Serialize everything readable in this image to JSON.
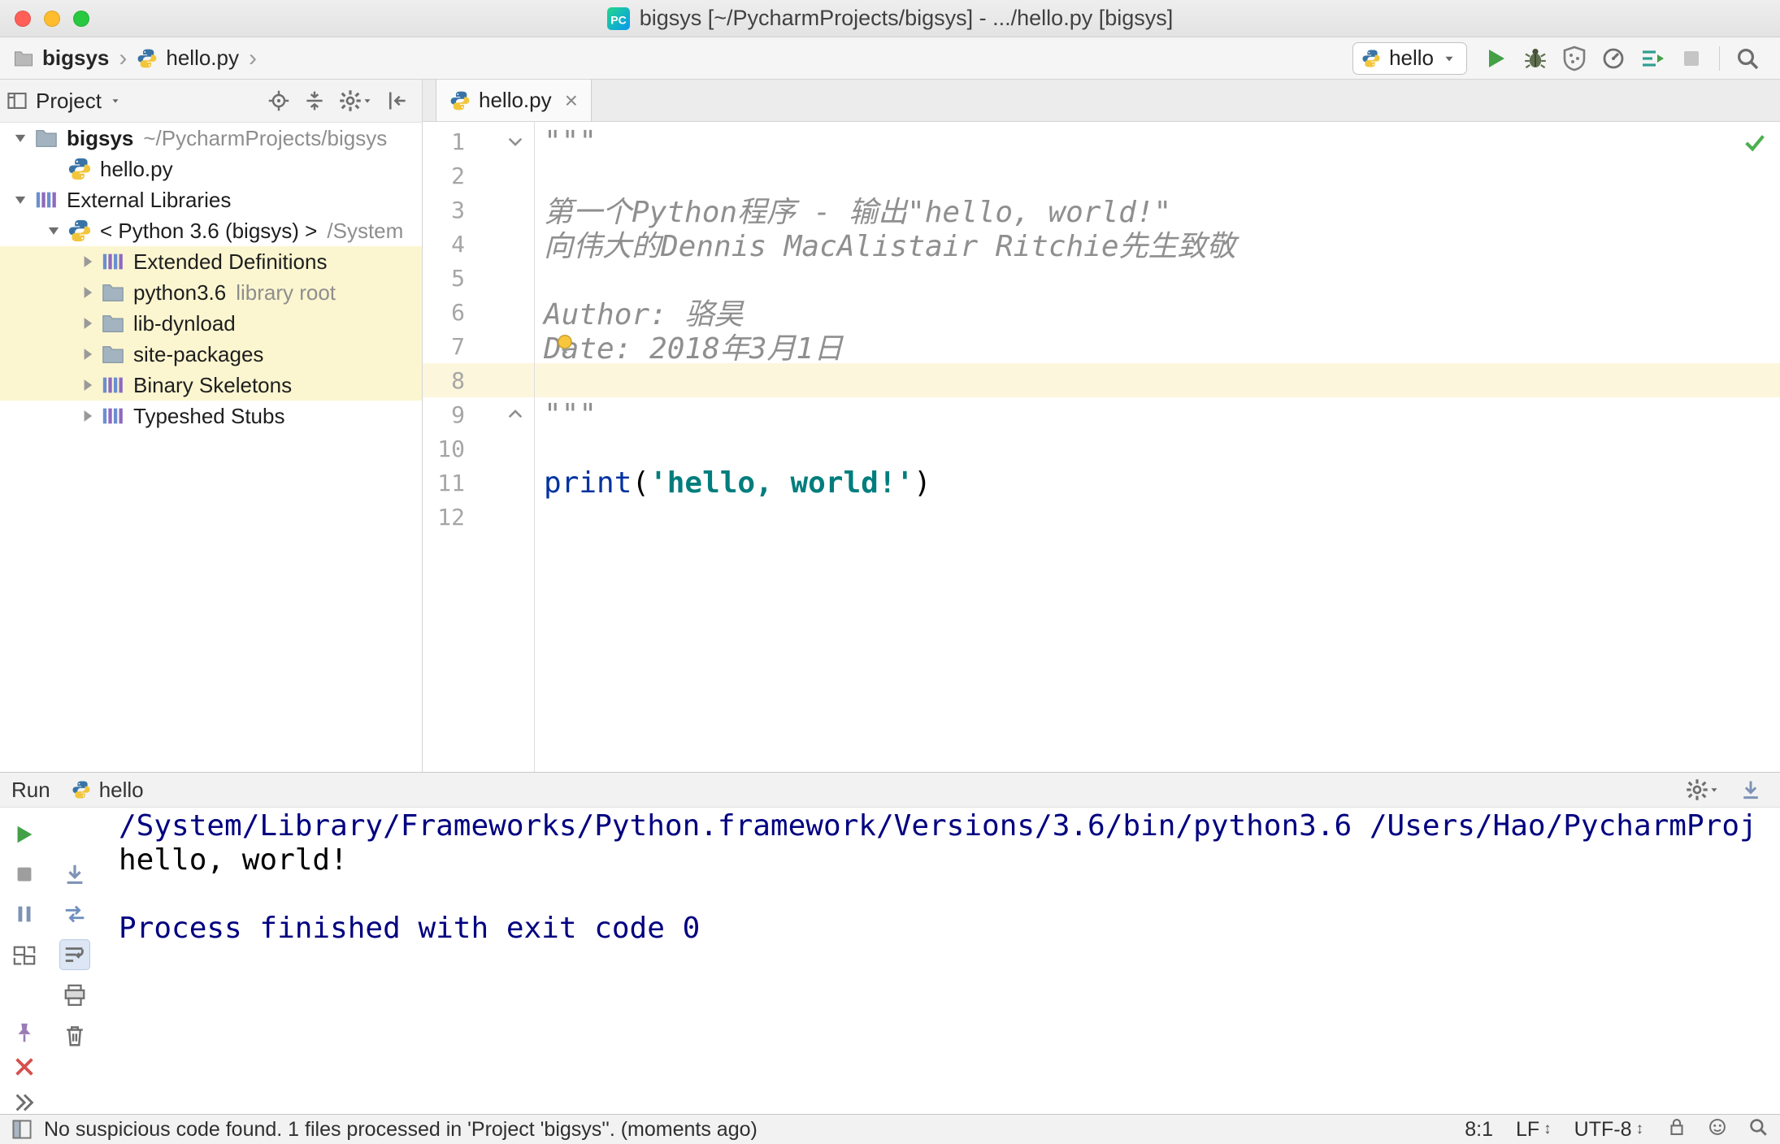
{
  "colors": {
    "current_line": "#fcf6dd",
    "library_highlight": "#fbf6d0",
    "doc_string": "#8f8f8f",
    "function_call": "#0032a0",
    "string": "#007d7d",
    "console_system": "#000080",
    "run_green": "#4caf50"
  },
  "titlebar": {
    "title": "bigsys [~/PycharmProjects/bigsys] - .../hello.py [bigsys]",
    "traffic_lights": {
      "close": "#ff5f57",
      "minimize": "#febc2e",
      "zoom": "#28c840"
    }
  },
  "toolbar": {
    "breadcrumbs": [
      "bigsys",
      "hello.py"
    ],
    "run_config": "hello",
    "actions": [
      {
        "name": "run",
        "icon": "play"
      },
      {
        "name": "debug",
        "icon": "bug"
      },
      {
        "name": "run-with-coverage",
        "icon": "coverage"
      },
      {
        "name": "profiler",
        "icon": "profiler"
      },
      {
        "name": "concurrency-diagram",
        "icon": "concurrency"
      },
      {
        "name": "stop",
        "icon": "stop",
        "disabled": true
      },
      {
        "name": "search-everywhere",
        "icon": "search",
        "sep_before": true
      }
    ]
  },
  "project_panel": {
    "header": {
      "title": "Project"
    },
    "header_actions": [
      {
        "name": "locate-file",
        "icon": "target"
      },
      {
        "name": "collapse-all",
        "icon": "collapse"
      },
      {
        "name": "settings",
        "icon": "gear",
        "caret": true
      },
      {
        "name": "hide-panel",
        "icon": "hide"
      }
    ],
    "tree": [
      {
        "indent": 0,
        "state": "open",
        "icon": "folder",
        "label": "bigsys",
        "suffix": "~/PycharmProjects/bigsys",
        "bold": true
      },
      {
        "indent": 1,
        "state": "none",
        "icon": "python",
        "label": "hello.py"
      },
      {
        "indent": 0,
        "state": "open",
        "icon": "bars",
        "label": "External Libraries"
      },
      {
        "indent": 1,
        "state": "open",
        "icon": "python",
        "label": "< Python 3.6 (bigsys) >",
        "suffix": "/System"
      },
      {
        "indent": 2,
        "state": "closed",
        "icon": "bars",
        "label": "Extended Definitions",
        "highlight": true
      },
      {
        "indent": 2,
        "state": "closed",
        "icon": "folder",
        "label": "python3.6",
        "suffix": "library root",
        "highlight": true
      },
      {
        "indent": 2,
        "state": "closed",
        "icon": "folder",
        "label": "lib-dynload",
        "highlight": true
      },
      {
        "indent": 2,
        "state": "closed",
        "icon": "folder",
        "label": "site-packages",
        "highlight": true
      },
      {
        "indent": 2,
        "state": "closed",
        "icon": "bars",
        "label": "Binary Skeletons",
        "highlight": true
      },
      {
        "indent": 2,
        "state": "closed",
        "icon": "bars",
        "label": "Typeshed Stubs"
      }
    ]
  },
  "editor": {
    "tab": "hello.py",
    "lines": [
      {
        "n": 1,
        "fold": "down",
        "segs": [
          {
            "c": "doc",
            "t": "\"\"\""
          }
        ]
      },
      {
        "n": 2,
        "segs": []
      },
      {
        "n": 3,
        "segs": [
          {
            "c": "doc",
            "t": "第一个Python程序 - 输出\"hello, world!\""
          }
        ]
      },
      {
        "n": 4,
        "segs": [
          {
            "c": "doc",
            "t": "向伟大的Dennis MacAlistair Ritchie先生致敬"
          }
        ]
      },
      {
        "n": 5,
        "segs": []
      },
      {
        "n": 6,
        "segs": [
          {
            "c": "doc",
            "t": "Author: 骆昊"
          }
        ]
      },
      {
        "n": 7,
        "bulb": true,
        "segs": [
          {
            "c": "doc",
            "t": "Date: 2018年3月1日"
          }
        ]
      },
      {
        "n": 8,
        "current": true,
        "segs": []
      },
      {
        "n": 9,
        "fold": "up",
        "segs": [
          {
            "c": "doc",
            "t": "\"\"\""
          }
        ]
      },
      {
        "n": 10,
        "segs": []
      },
      {
        "n": 11,
        "segs": [
          {
            "c": "fn",
            "t": "print"
          },
          {
            "c": "pl",
            "t": "("
          },
          {
            "c": "str",
            "t": "'hello, world!'"
          },
          {
            "c": "pl",
            "t": ")"
          }
        ]
      },
      {
        "n": 12,
        "segs": []
      }
    ]
  },
  "run_panel": {
    "title": "Run",
    "tab": "hello",
    "header_icons": [
      {
        "name": "console-settings",
        "icon": "gear",
        "caret": true
      },
      {
        "name": "scroll-down",
        "icon": "scroll-end"
      }
    ],
    "toolbar_left": [
      {
        "name": "rerun",
        "icon": "play"
      },
      {
        "name": "stop",
        "icon": "stop"
      },
      {
        "name": "pause-output",
        "icon": "pause"
      },
      {
        "name": "restore-layout",
        "icon": "layout"
      },
      {
        "name": "pin-tab",
        "icon": "pin"
      },
      {
        "name": "close",
        "icon": "close-red"
      },
      {
        "name": "more-options",
        "icon": "more"
      }
    ],
    "toolbar_right_col": [
      {
        "name": "scroll-to-end",
        "icon": "scroll-end"
      },
      {
        "name": "rerun-arrows",
        "icon": "swap"
      },
      {
        "name": "soft-wrap",
        "icon": "wrap",
        "active": true
      },
      {
        "name": "print",
        "icon": "print"
      },
      {
        "name": "clear-all",
        "icon": "trash"
      }
    ],
    "console": [
      {
        "kind": "system",
        "text": "/System/Library/Frameworks/Python.framework/Versions/3.6/bin/python3.6 /Users/Hao/PycharmProj"
      },
      {
        "kind": "stdout",
        "text": "hello, world!"
      },
      {
        "kind": "stdout",
        "text": ""
      },
      {
        "kind": "system",
        "text": "Process finished with exit code 0"
      }
    ]
  },
  "status_bar": {
    "message": "No suspicious code found. 1 files processed in 'Project 'bigsys''. (moments ago)",
    "position": "8:1",
    "line_separator": "LF",
    "encoding": "UTF-8",
    "icons": [
      {
        "name": "read-lock",
        "icon": "lock"
      },
      {
        "name": "hector-inspections",
        "icon": "face"
      },
      {
        "name": "search",
        "icon": "search"
      }
    ]
  }
}
